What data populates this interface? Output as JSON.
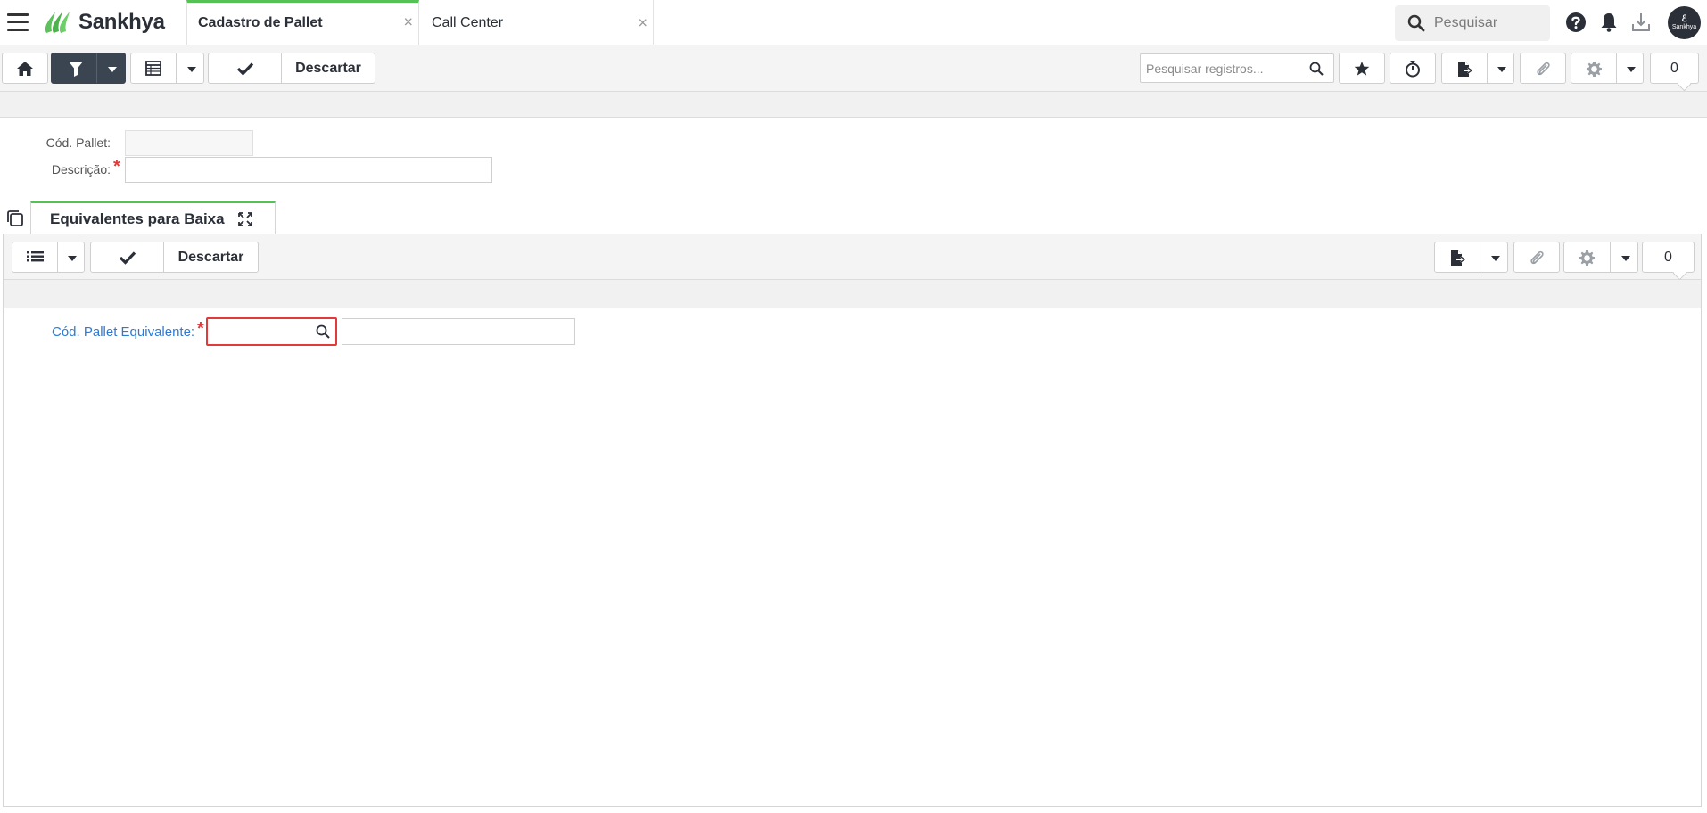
{
  "header": {
    "brand": "Sankhya",
    "tabs": [
      {
        "label": "Cadastro de Pallet",
        "active": true
      },
      {
        "label": "Call Center",
        "active": false
      }
    ],
    "tab_close_glyph": "×",
    "search_placeholder": "Pesquisar",
    "avatar_text": "Sankhya",
    "icons": [
      "menu-icon",
      "search-icon",
      "help-icon",
      "bell-icon",
      "download-icon"
    ]
  },
  "toolbar": {
    "discard_label": "Descartar",
    "records_search_placeholder": "Pesquisar registros...",
    "record_count": "0",
    "icons": [
      "home-icon",
      "filter-icon",
      "grid-icon",
      "check-icon",
      "star-icon",
      "stopwatch-icon",
      "file-export-icon",
      "paperclip-icon",
      "gear-icon"
    ]
  },
  "form": {
    "cod_pallet_label": "Cód. Pallet:",
    "cod_pallet_value": "",
    "descricao_label": "Descrição:",
    "descricao_value": "",
    "required_mark": "*"
  },
  "detail": {
    "tab_label": "Equivalentes para Baixa",
    "discard_label": "Descartar",
    "record_count": "0",
    "field_label": "Cód. Pallet Equivalente:",
    "field_value": "",
    "description_value": "",
    "required_mark": "*",
    "icons": [
      "list-icon",
      "check-icon",
      "file-export-icon",
      "paperclip-icon",
      "gear-icon",
      "expand-icon",
      "copy-icon"
    ]
  },
  "colors": {
    "accent_green": "#55c255",
    "dark_button": "#3b4451",
    "link_blue": "#2d7ad6",
    "required_red": "#e03a3a"
  }
}
